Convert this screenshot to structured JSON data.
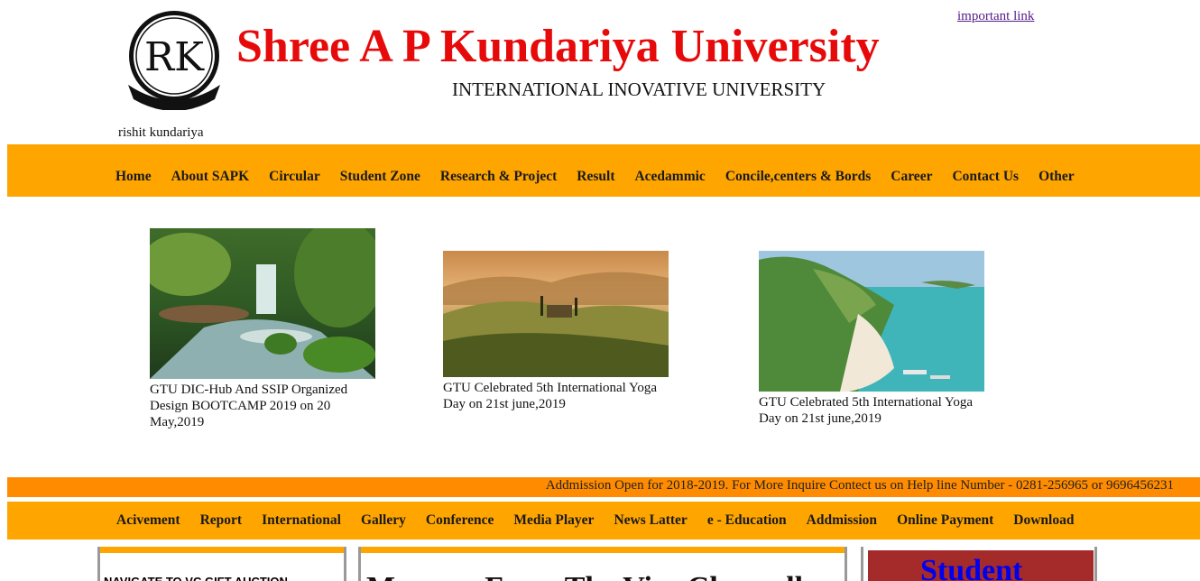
{
  "header": {
    "title": "Shree A P Kundariya University",
    "subtitle": "INTERNATIONAL INOVATIVE UNIVERSITY",
    "important_link": "important link",
    "owner": "rishit kundariya",
    "logo_text": "RK"
  },
  "nav_primary": [
    "Home",
    "About SAPK",
    "Circular",
    "Student Zone",
    "Research & Project",
    "Result",
    "Acedammic",
    "Concile,centers & Bords",
    "Career",
    "Contact Us",
    "Other"
  ],
  "gallery": [
    {
      "caption": "GTU DIC-Hub And SSIP Organized Design BOOTCAMP 2019 on 20 May,2019"
    },
    {
      "caption": "GTU Celebrated 5th International Yoga Day on 21st june,2019"
    },
    {
      "caption": "GTU Celebrated 5th International Yoga Day on 21st june,2019"
    }
  ],
  "ticker": "Addmission Open for 2018-2019. For More Inquire Contect us on Help line Number - 0281-256965 or 9696456231",
  "nav_secondary": [
    "Acivement",
    "Report",
    "International",
    "Gallery",
    "Conference",
    "Media Player",
    "News Latter",
    "e - Education",
    "Addmission",
    "Online Payment",
    "Download"
  ],
  "panels": {
    "left": "NAVIGATE TO VC GIFT AUCTION",
    "center": "Message From The Vice Chancellor",
    "right": "Student"
  },
  "colors": {
    "accent": "#ffa500",
    "ticker_bg": "#ff8c00",
    "title_red": "#e60a0a",
    "panel_maroon": "#a52a2a"
  }
}
